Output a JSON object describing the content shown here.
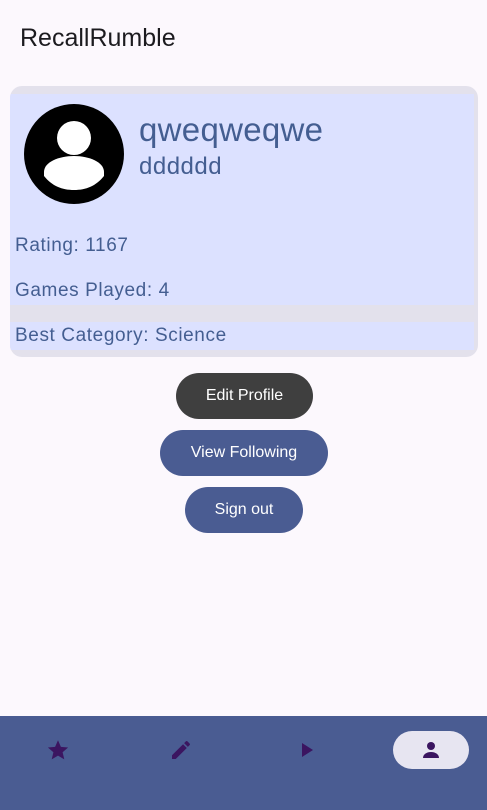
{
  "app": {
    "title": "RecallRumble"
  },
  "profile": {
    "username": "qweqweqwe",
    "handle": "dddddd",
    "stats": {
      "rating": "Rating: 1167",
      "games_played": "Games Played: 4",
      "best_category": "Best Category: Science"
    }
  },
  "actions": {
    "edit_profile": "Edit Profile",
    "view_following": "View Following",
    "sign_out": "Sign out"
  },
  "bottom_nav": {
    "items": [
      {
        "icon": "star-icon",
        "selected": false
      },
      {
        "icon": "pencil-icon",
        "selected": false
      },
      {
        "icon": "play-icon",
        "selected": false
      },
      {
        "icon": "person-icon",
        "selected": true
      }
    ]
  },
  "colors": {
    "accent": "#4a5c92",
    "card_header": "#dce1ff",
    "text_accent": "#445e91",
    "nav_icon": "#3b1560",
    "selected_pill": "#e7e5f1"
  }
}
